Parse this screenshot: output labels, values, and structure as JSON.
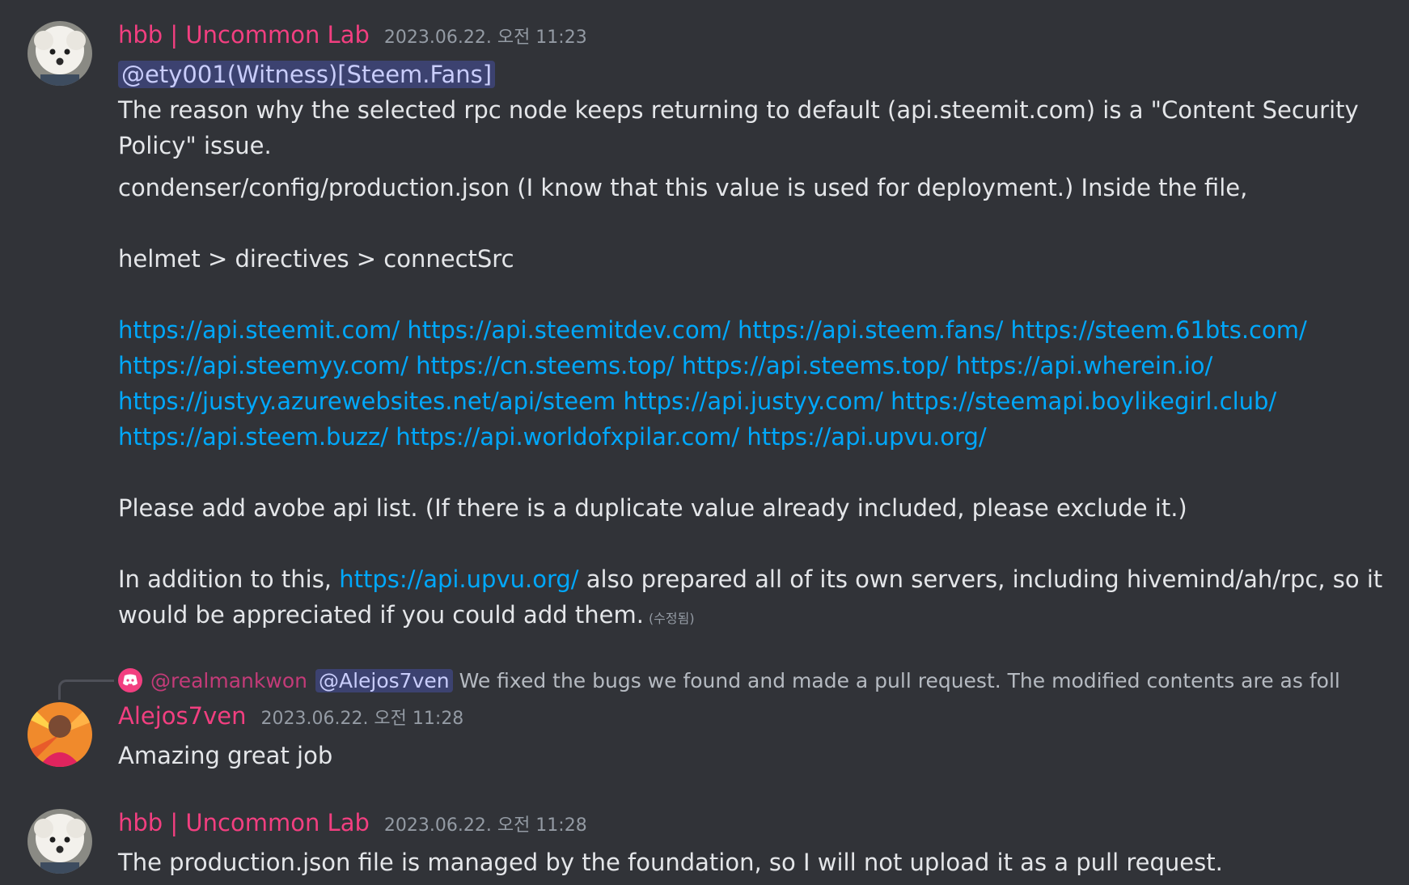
{
  "messages": [
    {
      "author": "hbb | Uncommon Lab",
      "timestamp": "2023.06.22. 오전 11:23",
      "avatar_icon": "white-poodle-avatar",
      "mention": "@ety001(Witness)[Steem.Fans]",
      "para1": [
        "The reason why the selected rpc node keeps returning to default (api.steemit.com) is a \"Content Security",
        "Policy\" issue."
      ],
      "line_config": "condenser/config/production.json (I know that this value is used for deployment.) Inside the file,",
      "line_path": "helmet > directives > connectSrc",
      "links": [
        [
          "https://api.steemit.com/",
          "https://api.steemitdev.com/",
          "https://api.steem.fans/",
          "https://steem.61bts.com/"
        ],
        [
          "https://api.steemyy.com/",
          "https://cn.steems.top/",
          "https://api.steems.top/",
          "https://api.wherein.io/"
        ],
        [
          "https://justyy.azurewebsites.net/api/steem",
          "https://api.justyy.com/",
          "https://steemapi.boylikegirl.club/"
        ],
        [
          "https://api.steem.buzz/",
          "https://api.worldofxpilar.com/",
          "https://api.upvu.org/"
        ]
      ],
      "line_please": "Please add avobe api list. (If there is a duplicate value already included, please exclude it.)",
      "addition_prefix": "In addition to this, ",
      "addition_link": "https://api.upvu.org/",
      "addition_suffix": " also prepared all of its own servers, including hivemind/ah/rpc, so it",
      "addition_line2": "would be appreciated if you could add them.",
      "edited": "(수정됨)"
    },
    {
      "reply": {
        "name": "@realmankwon",
        "mention": "@Alejos7ven",
        "text": "We fixed the bugs we found and made a pull request. The modified contents are as follows. • F",
        "icon": "discord-icon"
      },
      "author": "Alejos7ven",
      "timestamp": "2023.06.22. 오전 11:28",
      "avatar_icon": "person-avatar",
      "text": "Amazing great job"
    },
    {
      "author": "hbb | Uncommon Lab",
      "timestamp": "2023.06.22. 오전 11:28",
      "avatar_icon": "white-poodle-avatar",
      "text": "The production.json file is managed by the foundation, so I will not upload it as a pull request."
    }
  ],
  "colors": {
    "background": "#313338",
    "author": "#f23f80",
    "link": "#00a8fc",
    "mention_bg": "#3c4270"
  }
}
